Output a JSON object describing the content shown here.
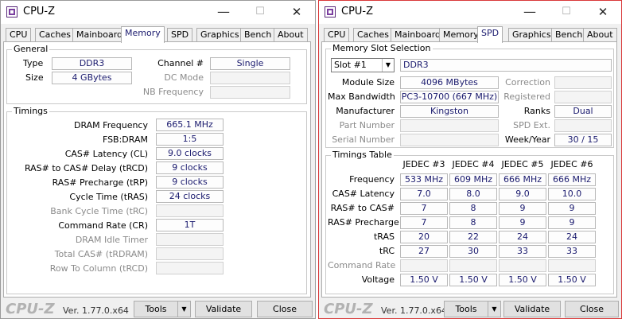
{
  "window_left": {
    "title": "CPU-Z",
    "titlebar_buttons": {
      "minimize": "—",
      "maximize": "☐",
      "close": "✕"
    },
    "tabs": [
      {
        "label": "CPU",
        "active": false
      },
      {
        "label": "Caches",
        "active": false
      },
      {
        "label": "Mainboard",
        "active": false
      },
      {
        "label": "Memory",
        "active": true
      },
      {
        "label": "SPD",
        "active": false
      },
      {
        "label": "Graphics",
        "active": false
      },
      {
        "label": "Bench",
        "active": false
      },
      {
        "label": "About",
        "active": false
      }
    ],
    "general": {
      "title": "General",
      "type_label": "Type",
      "type_value": "DDR3",
      "size_label": "Size",
      "size_value": "4 GBytes",
      "channel_label": "Channel #",
      "channel_value": "Single",
      "dc_mode_label": "DC Mode",
      "dc_mode_value": "",
      "nb_frequency_label": "NB Frequency",
      "nb_frequency_value": ""
    },
    "timings": {
      "title": "Timings",
      "rows": [
        {
          "label": "DRAM Frequency",
          "value": "665.1 MHz"
        },
        {
          "label": "FSB:DRAM",
          "value": "1:5"
        },
        {
          "label": "CAS# Latency (CL)",
          "value": "9.0 clocks"
        },
        {
          "label": "RAS# to CAS# Delay (tRCD)",
          "value": "9 clocks"
        },
        {
          "label": "RAS# Precharge (tRP)",
          "value": "9 clocks"
        },
        {
          "label": "Cycle Time (tRAS)",
          "value": "24 clocks"
        },
        {
          "label": "Bank Cycle Time (tRC)",
          "value": ""
        },
        {
          "label": "Command Rate (CR)",
          "value": "1T"
        },
        {
          "label": "DRAM Idle Timer",
          "value": ""
        },
        {
          "label": "Total CAS# (tRDRAM)",
          "value": ""
        },
        {
          "label": "Row To Column (tRCD)",
          "value": ""
        }
      ]
    },
    "footer": {
      "brand": "CPU-Z",
      "version": "Ver. 1.77.0.x64",
      "tools_label": "Tools",
      "validate_label": "Validate",
      "close_label": "Close"
    }
  },
  "window_right": {
    "title": "CPU-Z",
    "titlebar_buttons": {
      "minimize": "—",
      "maximize": "☐",
      "close": "✕"
    },
    "tabs": [
      {
        "label": "CPU",
        "active": false
      },
      {
        "label": "Caches",
        "active": false
      },
      {
        "label": "Mainboard",
        "active": false
      },
      {
        "label": "Memory",
        "active": false
      },
      {
        "label": "SPD",
        "active": true
      },
      {
        "label": "Graphics",
        "active": false
      },
      {
        "label": "Bench",
        "active": false
      },
      {
        "label": "About",
        "active": false
      }
    ],
    "slot_selection": {
      "title": "Memory Slot Selection",
      "slot_value": "Slot #1",
      "type_value": "DDR3",
      "module_size_label": "Module Size",
      "module_size_value": "4096 MBytes",
      "max_bandwidth_label": "Max Bandwidth",
      "max_bandwidth_value": "PC3-10700 (667 MHz)",
      "manufacturer_label": "Manufacturer",
      "manufacturer_value": "Kingston",
      "part_number_label": "Part Number",
      "part_number_value": "",
      "serial_number_label": "Serial Number",
      "serial_number_value": "",
      "correction_label": "Correction",
      "correction_value": "",
      "registered_label": "Registered",
      "registered_value": "",
      "ranks_label": "Ranks",
      "ranks_value": "Dual",
      "spd_ext_label": "SPD Ext.",
      "spd_ext_value": "",
      "week_year_label": "Week/Year",
      "week_year_value": "30 / 15"
    },
    "timings_table": {
      "title": "Timings Table",
      "columns": [
        "JEDEC #3",
        "JEDEC #4",
        "JEDEC #5",
        "JEDEC #6"
      ],
      "rows": [
        {
          "label": "Frequency",
          "values": [
            "533 MHz",
            "609 MHz",
            "666 MHz",
            "666 MHz"
          ]
        },
        {
          "label": "CAS# Latency",
          "values": [
            "7.0",
            "8.0",
            "9.0",
            "10.0"
          ]
        },
        {
          "label": "RAS# to CAS#",
          "values": [
            "7",
            "8",
            "9",
            "9"
          ]
        },
        {
          "label": "RAS# Precharge",
          "values": [
            "7",
            "8",
            "9",
            "9"
          ]
        },
        {
          "label": "tRAS",
          "values": [
            "20",
            "22",
            "24",
            "24"
          ]
        },
        {
          "label": "tRC",
          "values": [
            "27",
            "30",
            "33",
            "33"
          ]
        },
        {
          "label": "Command Rate",
          "values": [
            "",
            "",
            "",
            ""
          ]
        },
        {
          "label": "Voltage",
          "values": [
            "1.50 V",
            "1.50 V",
            "1.50 V",
            "1.50 V"
          ]
        }
      ]
    },
    "footer": {
      "brand": "CPU-Z",
      "version": "Ver. 1.77.0.x64",
      "tools_label": "Tools",
      "validate_label": "Validate",
      "close_label": "Close"
    }
  }
}
